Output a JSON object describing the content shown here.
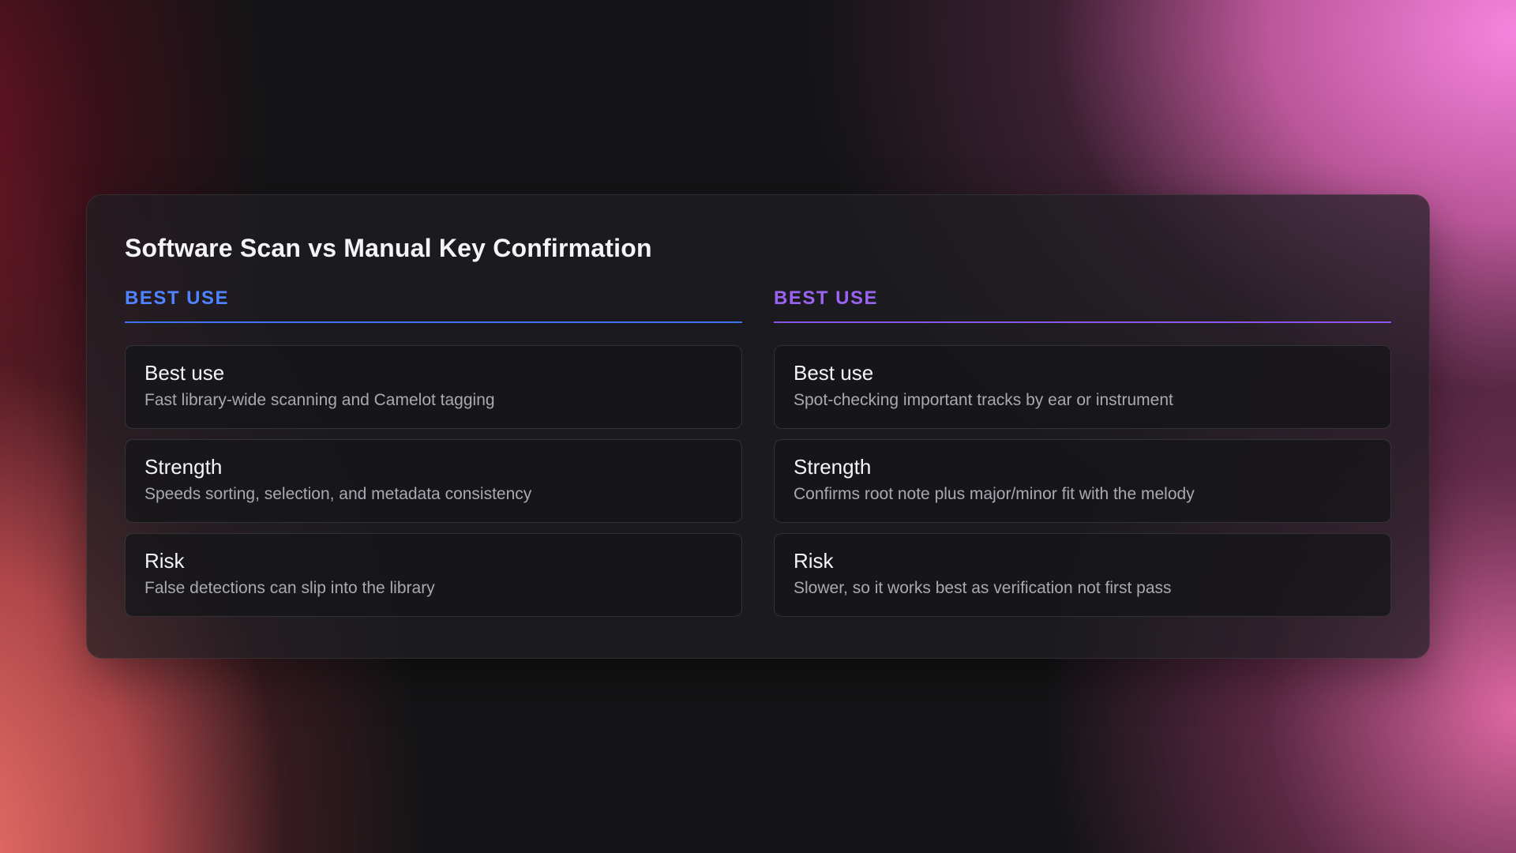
{
  "title": "Software Scan vs Manual Key Confirmation",
  "colors": {
    "left_accent": "#4f83ff",
    "right_accent": "#9b63f2"
  },
  "columns": [
    {
      "heading": "BEST USE",
      "items": [
        {
          "label": "Best use",
          "text": "Fast library-wide scanning and Camelot tagging"
        },
        {
          "label": "Strength",
          "text": "Speeds sorting, selection, and metadata consistency"
        },
        {
          "label": "Risk",
          "text": "False detections can slip into the library"
        }
      ]
    },
    {
      "heading": "BEST USE",
      "items": [
        {
          "label": "Best use",
          "text": "Spot-checking important tracks by ear or instrument"
        },
        {
          "label": "Strength",
          "text": "Confirms root note plus major/minor fit with the melody"
        },
        {
          "label": "Risk",
          "text": "Slower, so it works best as verification not first pass"
        }
      ]
    }
  ]
}
